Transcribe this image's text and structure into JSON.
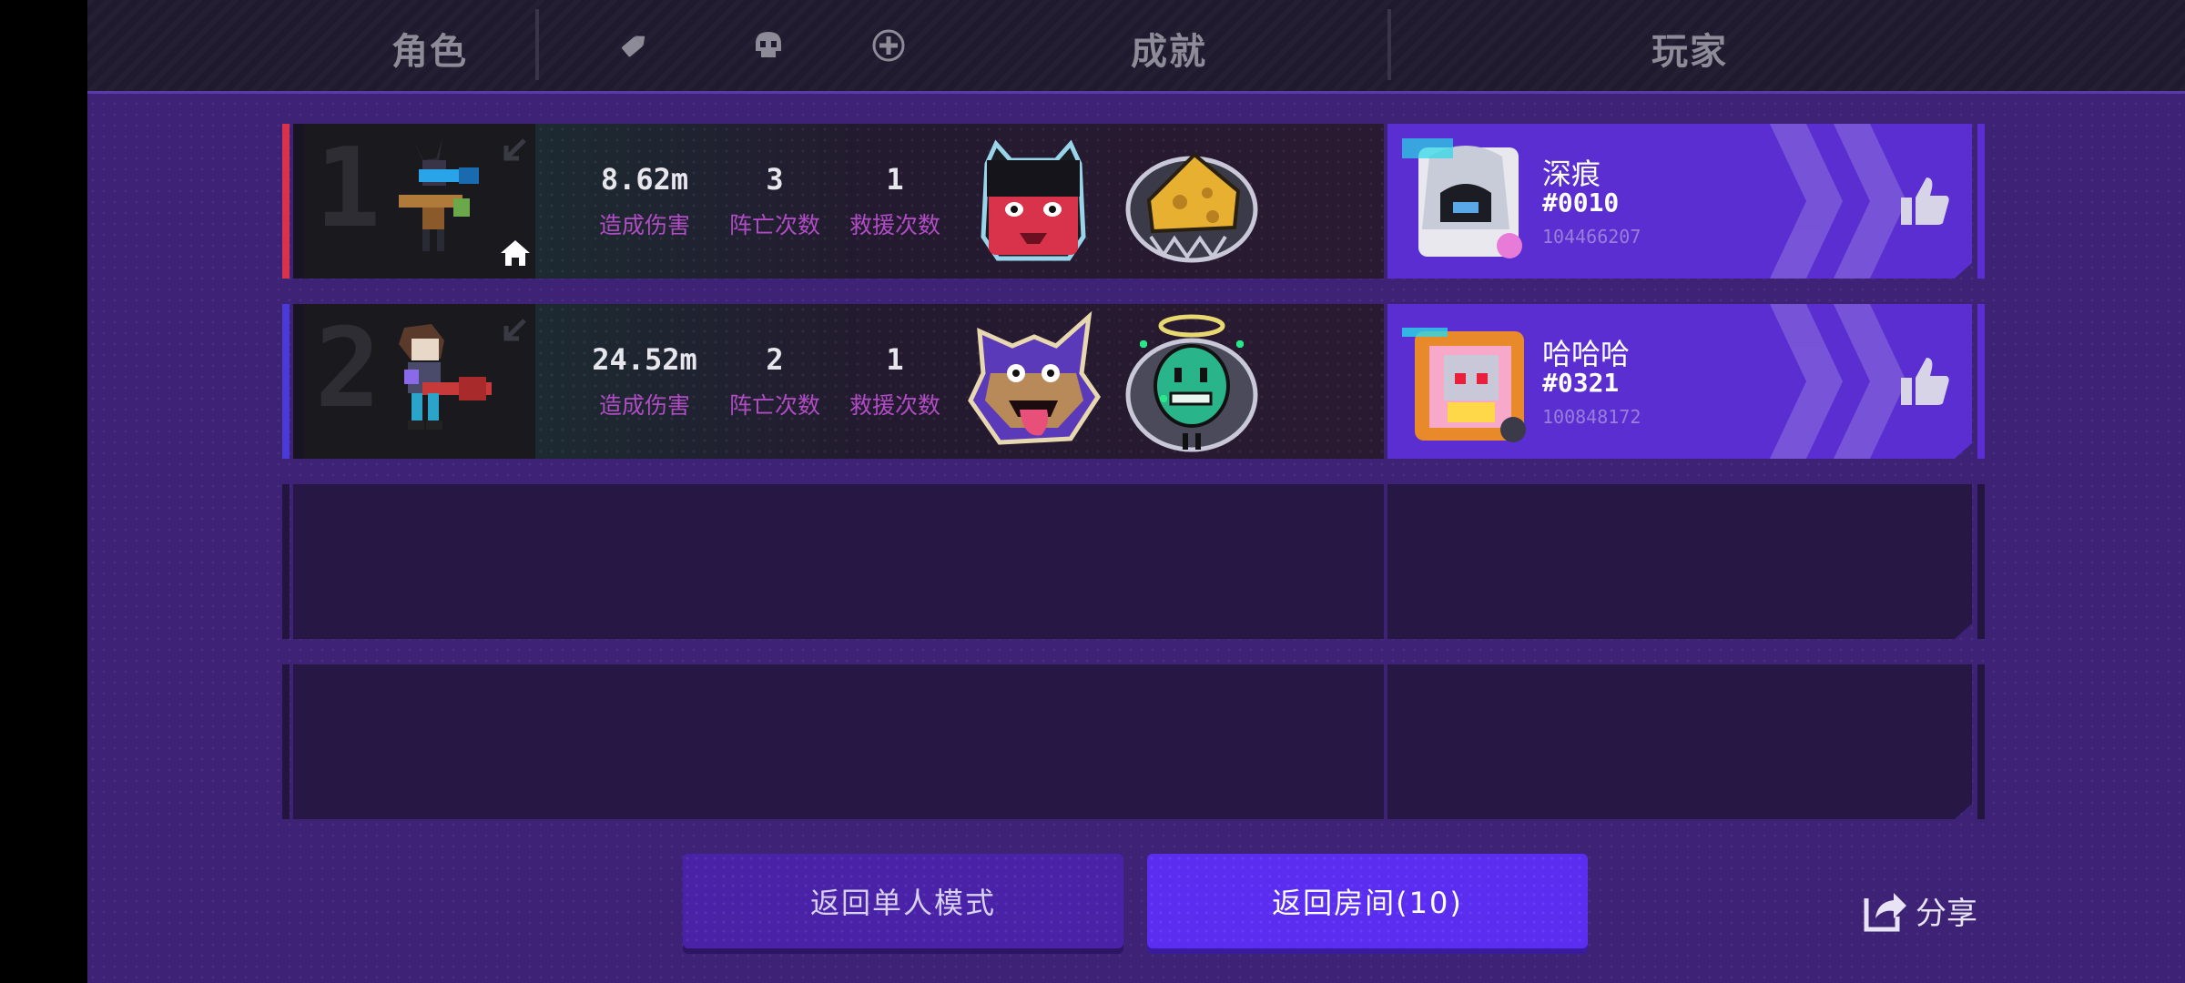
{
  "header": {
    "col_character": "角色",
    "col_achievement": "成就",
    "col_player": "玩家",
    "icons": [
      "bullet-icon",
      "skull-icon",
      "revive-icon"
    ]
  },
  "rows": [
    {
      "rank": "1",
      "accent_color": "#d8334a",
      "damage": "8.62m",
      "damage_label": "造成伤害",
      "deaths": "3",
      "deaths_label": "阵亡次数",
      "rescues": "1",
      "rescues_label": "救援次数",
      "badges": [
        "red-demon-girl-badge",
        "cheese-badge"
      ],
      "player_name": "深痕",
      "player_tag": "#0010",
      "player_id": "104466207",
      "is_host": true
    },
    {
      "rank": "2",
      "accent_color": "#4a3ad8",
      "damage": "24.52m",
      "damage_label": "造成伤害",
      "deaths": "2",
      "deaths_label": "阵亡次数",
      "rescues": "1",
      "rescues_label": "救援次数",
      "badges": [
        "purple-wolf-badge",
        "green-angel-blob-badge"
      ],
      "player_name": "哈哈哈",
      "player_tag": "#0321",
      "player_id": "100848172",
      "is_host": false
    }
  ],
  "buttons": {
    "back_single": "返回单人模式",
    "back_room": "返回房间(10)",
    "share": "分享"
  }
}
